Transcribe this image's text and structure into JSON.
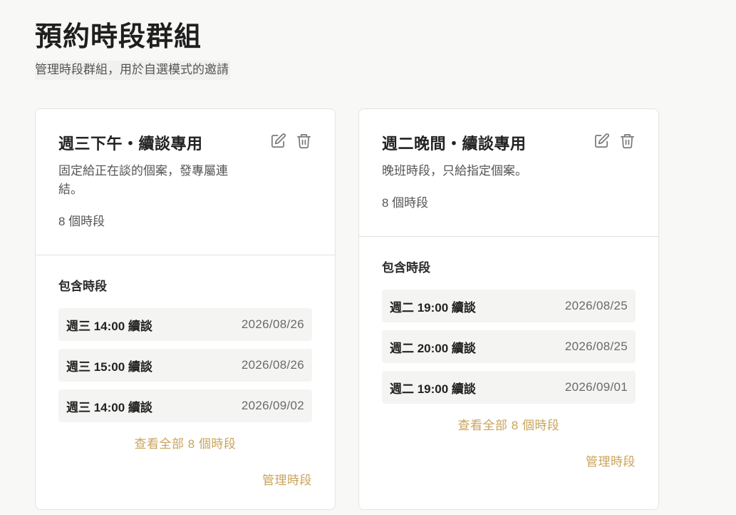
{
  "header": {
    "title": "預約時段群組",
    "subtitle": "管理時段群組，用於自選模式的邀請"
  },
  "groups": [
    {
      "title": "週三下午・續談專用",
      "description": "固定給正在談的個案，發專屬連結。",
      "count_label": "8 個時段",
      "section_label": "包含時段",
      "slots": [
        {
          "name": "週三 14:00 續談",
          "date": "2026/08/26"
        },
        {
          "name": "週三 15:00 續談",
          "date": "2026/08/26"
        },
        {
          "name": "週三 14:00 續談",
          "date": "2026/09/02"
        }
      ],
      "view_all_label": "查看全部 8 個時段",
      "manage_label": "管理時段",
      "icons": {
        "edit": "edit-icon",
        "delete": "trash-icon"
      }
    },
    {
      "title": "週二晚間・續談專用",
      "description": "晚班時段，只給指定個案。",
      "count_label": "8 個時段",
      "section_label": "包含時段",
      "slots": [
        {
          "name": "週二 19:00 續談",
          "date": "2026/08/25"
        },
        {
          "name": "週二 20:00 續談",
          "date": "2026/08/25"
        },
        {
          "name": "週二 19:00 續談",
          "date": "2026/09/01"
        }
      ],
      "view_all_label": "查看全部 8 個時段",
      "manage_label": "管理時段",
      "icons": {
        "edit": "edit-icon",
        "delete": "trash-icon"
      }
    }
  ],
  "colors": {
    "accent": "#c9a35a",
    "background": "#f8f8f6",
    "card": "#ffffff",
    "slot_bg": "#f4f4f3"
  }
}
